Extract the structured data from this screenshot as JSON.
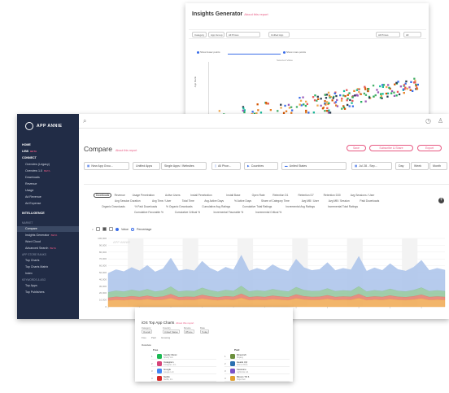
{
  "insights_generator": {
    "title": "Insights Generator",
    "subtitle": "About this report",
    "filters": [
      "Category",
      "App Group",
      "All Prices",
      "Unified App",
      "All Prices",
      "All"
    ],
    "legend": [
      "Show fewer points",
      "Show more points",
      "Selected Value"
    ],
    "y_axis_label": "App Rank"
  },
  "sidebar": {
    "brand": "APP ANNIE",
    "items": [
      {
        "label": "HOME",
        "type": "strong"
      },
      {
        "label": "LIBS",
        "badge": "BETA",
        "type": "strong"
      },
      {
        "label": "CONNECT",
        "type": "strong"
      },
      {
        "label": "Overview (Legacy)",
        "type": "indent"
      },
      {
        "label": "Overview 1.0",
        "badge": "BETA",
        "type": "indent"
      },
      {
        "label": "Downloads",
        "type": "indent"
      },
      {
        "label": "Revenue",
        "type": "indent"
      },
      {
        "label": "Usage",
        "type": "indent"
      },
      {
        "label": "Ad Revenue",
        "type": "indent"
      },
      {
        "label": "Ad Expense",
        "type": "indent"
      },
      {
        "label": "INTELLIGENCE",
        "type": "section"
      },
      {
        "label": "MARKET",
        "type": "dim"
      },
      {
        "label": "Compare",
        "type": "active"
      },
      {
        "label": "Insights Generator",
        "badge": "BETA",
        "type": "indent"
      },
      {
        "label": "Word Cloud",
        "type": "indent"
      },
      {
        "label": "Advanced Search",
        "badge": "BETA",
        "type": "indent"
      },
      {
        "label": "APP STORE RANKS",
        "type": "dim"
      },
      {
        "label": "Top Charts",
        "type": "indent"
      },
      {
        "label": "Top Charts Matrix",
        "type": "indent"
      },
      {
        "label": "Index",
        "type": "indent"
      },
      {
        "label": "KEYWORDS & ASO",
        "type": "dim"
      },
      {
        "label": "Top Apps",
        "type": "indent"
      },
      {
        "label": "Top Publishers",
        "type": "indent"
      }
    ]
  },
  "page": {
    "title": "Compare",
    "subtitle": "About this report",
    "buttons": [
      "Save",
      "Subscribe & Share",
      "Export"
    ]
  },
  "filters": [
    {
      "label": "New App Grou...",
      "icon": "▦"
    },
    {
      "label": "Unified Apps"
    },
    {
      "label": "Single Apps / Websites"
    },
    {
      "label": "All Phon...",
      "icon": "▯"
    },
    {
      "label": "Countries",
      "icon": "▶"
    },
    {
      "label": "United States",
      "icon": "▬"
    },
    {
      "label": "Jul 28 - Sep...",
      "icon": "▦"
    },
    {
      "label": "Day"
    },
    {
      "label": "Week"
    },
    {
      "label": "Month"
    }
  ],
  "metric_tabs": {
    "row1": [
      "Downloads",
      "Revenue",
      "Usage Penetration",
      "Active Users",
      "Install Penetration",
      "Install Base",
      "Open Rate",
      "Retention D1",
      "Retention D7",
      "Retention D30",
      "Avg Sessions / User"
    ],
    "row2": [
      "Avg Session Duration",
      "Avg Time / User",
      "Total Time",
      "Avg Active Days",
      "% Active Days",
      "Share of Category Time",
      "Avg MB / User",
      "Avg MB / Session",
      "Paid Downloads"
    ],
    "row3": [
      "Organic Downloads",
      "% Paid Downloads",
      "% Organic Downloads",
      "Cumulative Avg Ratings",
      "Cumulative Total Ratings",
      "Incremental Avg Ratings",
      "Incremental Total Ratings"
    ],
    "row4": [
      "Cumulative Favorable %",
      "Cumulative Critical %",
      "Incremental Favorable %",
      "Incremental Critical %"
    ]
  },
  "chart_controls": {
    "value_label": "Value",
    "percentage_label": "Percentage",
    "watermark": "APP ANNIE"
  },
  "chart_data": {
    "type": "area",
    "y_ticks": [
      "100,000",
      "90,000",
      "80,000",
      "70,000",
      "60,000",
      "50,000",
      "40,000",
      "30,000",
      "20,000",
      "10,000",
      "0"
    ],
    "ylim": [
      0,
      100000
    ],
    "series": [
      {
        "name": "Series 1",
        "color": "#f0a850",
        "values": [
          9000,
          10000,
          9500,
          10500,
          9800,
          11000,
          9700,
          10200,
          12500,
          9600,
          10100,
          9900,
          11800,
          10400,
          9500,
          10600,
          10000,
          12800,
          9700,
          10300,
          9800,
          11000,
          10200,
          9600,
          12200,
          10500,
          9900,
          10100,
          11500,
          9800,
          10300,
          10000,
          12600,
          9600,
          10400,
          9900,
          11200,
          10100,
          9700,
          10500,
          12000,
          9800,
          10300,
          9900
        ]
      },
      {
        "name": "Series 2",
        "color": "#e57a6a",
        "values": [
          4000,
          4500,
          4200,
          4800,
          4300,
          5000,
          4100,
          4600,
          5800,
          4200,
          4500,
          4300,
          5400,
          4600,
          4100,
          4700,
          4400,
          6000,
          4200,
          4600,
          4300,
          5000,
          4500,
          4200,
          5600,
          4700,
          4300,
          4400,
          5200,
          4300,
          4600,
          4400,
          5900,
          4200,
          4600,
          4300,
          5100,
          4400,
          4200,
          4700,
          5500,
          4300,
          4600,
          4300
        ]
      },
      {
        "name": "Series 3",
        "color": "#8fc49b",
        "values": [
          8000,
          8800,
          8300,
          9200,
          8500,
          9600,
          8200,
          8900,
          11000,
          8300,
          8700,
          8500,
          10400,
          9000,
          8200,
          9100,
          8600,
          11500,
          8300,
          8900,
          8500,
          9600,
          8800,
          8300,
          10800,
          9100,
          8500,
          8600,
          10000,
          8500,
          8900,
          8600,
          11200,
          8300,
          9000,
          8500,
          9800,
          8600,
          8300,
          9100,
          10500,
          8500,
          8900,
          8500
        ]
      },
      {
        "name": "Series 4",
        "color": "#a9c2ea",
        "values": [
          28000,
          31000,
          29500,
          33000,
          30000,
          35000,
          29000,
          32000,
          42000,
          30500,
          31500,
          30000,
          39000,
          32500,
          29500,
          33500,
          31000,
          45000,
          30000,
          32500,
          30500,
          36000,
          32000,
          30000,
          41000,
          33000,
          30500,
          31500,
          38000,
          30500,
          32500,
          31000,
          44000,
          30000,
          33000,
          30500,
          37000,
          31500,
          30000,
          33500,
          40000,
          30500,
          32500,
          31000
        ]
      }
    ]
  },
  "top_app_charts": {
    "title": "iOS Top App Charts",
    "subtitle": "About this report",
    "labels": [
      "Category",
      "Country",
      "Device",
      "Date"
    ],
    "filter_values": [
      "Overall",
      "United States",
      "iPhone",
      "Today"
    ],
    "options": [
      "Free",
      "Paid",
      "Grossing"
    ],
    "table_title": "Overview",
    "columns": [
      "Free",
      "Paid"
    ],
    "free_apps": [
      {
        "rank": "1",
        "name": "Spotify Music",
        "publisher": "Spotify Ltd.",
        "color": "#1db954"
      },
      {
        "rank": "2",
        "name": "Instagram",
        "publisher": "Instagram, Inc.",
        "color": "#d6457a"
      },
      {
        "rank": "3",
        "name": "Google",
        "publisher": "Google LLC",
        "color": "#4285f4"
      },
      {
        "rank": "4",
        "name": "Netflix",
        "publisher": "Netflix, Inc.",
        "color": "#d62828"
      }
    ],
    "paid_apps": [
      {
        "rank": "1",
        "name": "Minecraft",
        "publisher": "Mojang",
        "color": "#6b8e3c"
      },
      {
        "rank": "2",
        "name": "Heads Up!",
        "publisher": "Warner Bros.",
        "color": "#2a6fb0"
      },
      {
        "rank": "3",
        "name": "Facetune",
        "publisher": "Lightricks Ltd.",
        "color": "#7a52c7"
      },
      {
        "rank": "4",
        "name": "Bloons TD 6",
        "publisher": "Ninja Kiwi",
        "color": "#e0a030"
      }
    ]
  }
}
